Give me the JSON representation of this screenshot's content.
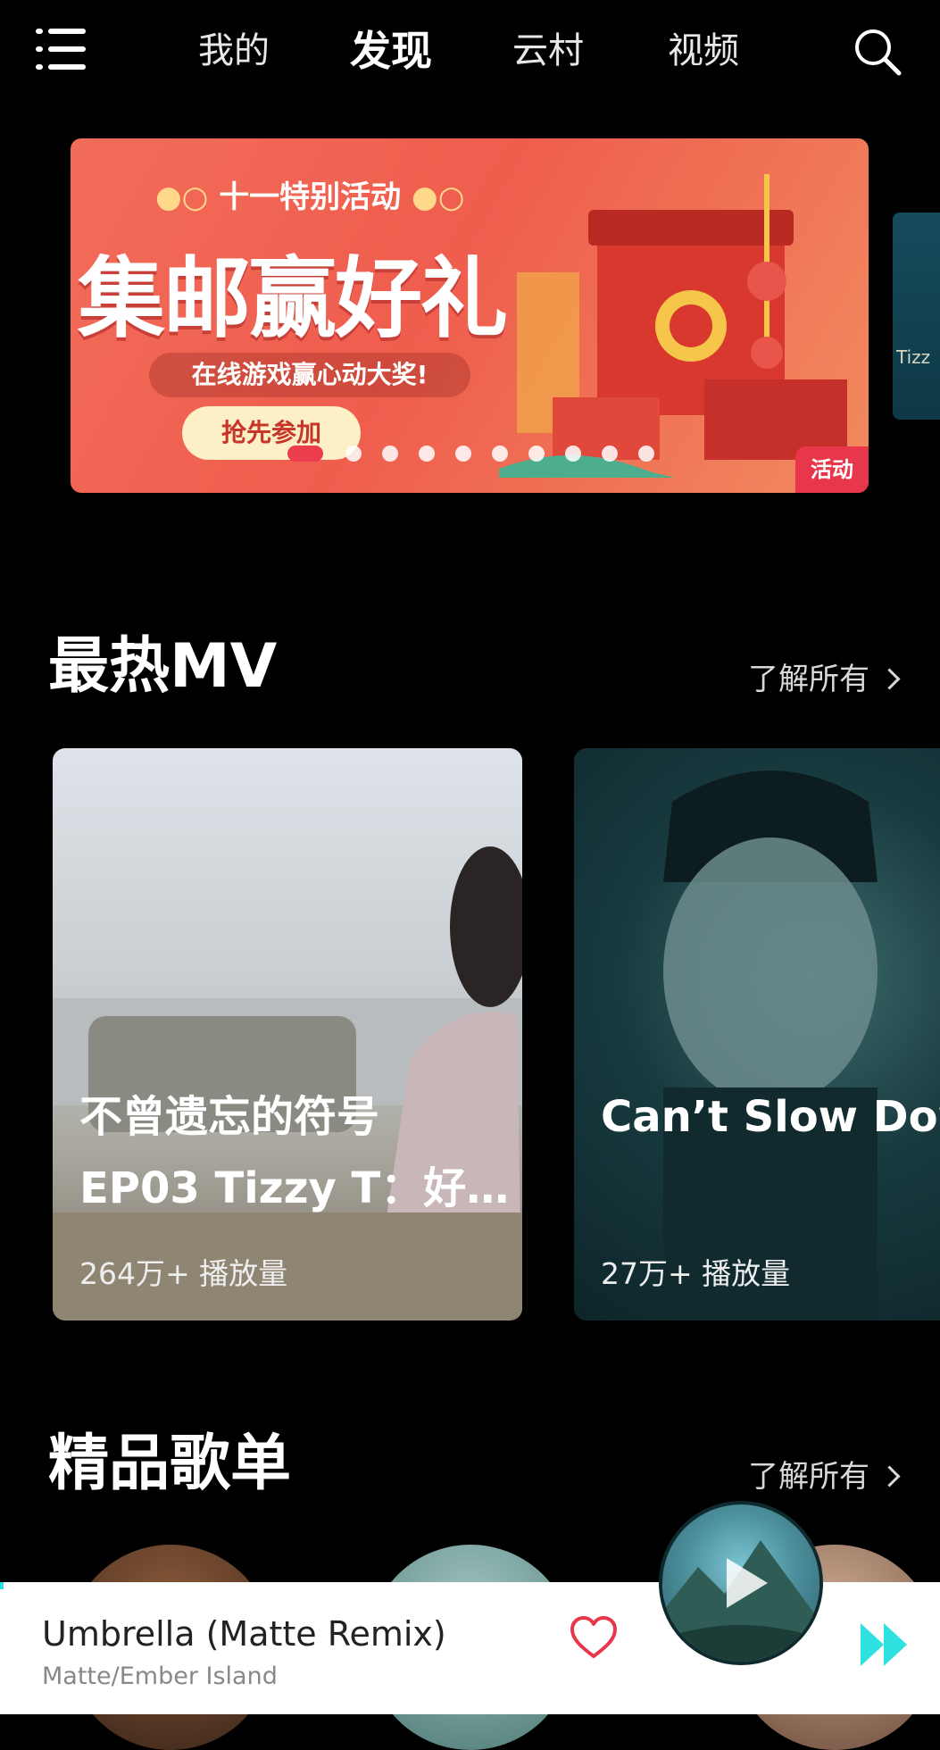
{
  "nav": {
    "tabs": [
      {
        "label": "我的",
        "active": false
      },
      {
        "label": "发现",
        "active": true
      },
      {
        "label": "云村",
        "active": false
      },
      {
        "label": "视频",
        "active": false
      }
    ],
    "menu_icon": "menu-icon",
    "search_icon": "search-icon"
  },
  "banner": {
    "subtitle": "十一特别活动",
    "title": "集邮赢好礼",
    "tagline": "在线游戏赢心动大奖!",
    "cta": "抢先参加",
    "tag": "活动",
    "dots_total": 10,
    "active_dot": 0,
    "peek_text": "Tizz"
  },
  "sections": {
    "mv": {
      "title": "最热MV",
      "see_all": "了解所有",
      "items": [
        {
          "title_line1": "不曾遗忘的符号",
          "title_line2": "EP03 Tizzy T：好…",
          "plays": "264万+ 播放量"
        },
        {
          "title_line1": "Can’t Slow Down",
          "plays": "27万+ 播放量"
        }
      ]
    },
    "playlists": {
      "title": "精品歌单",
      "see_all": "了解所有"
    }
  },
  "player": {
    "song": "Umbrella (Matte Remix)",
    "artist": "Matte/Ember Island",
    "like_icon": "heart-icon",
    "next_icon": "next-icon",
    "colors": {
      "accent": "#2ee0e0",
      "heart": "#e8364a"
    }
  }
}
